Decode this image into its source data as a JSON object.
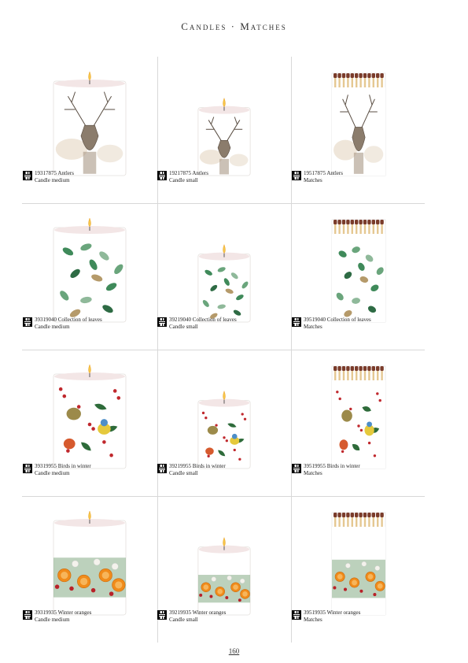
{
  "page": {
    "title": "Candles · Matches",
    "page_number": "160"
  },
  "rows": [
    {
      "motif": "antlers",
      "items": [
        {
          "code_name": "19317875 Antlers",
          "product": "Candle medium"
        },
        {
          "code_name": "19217875 Antlers",
          "product": "Candle small"
        },
        {
          "code_name": "19517875 Antlers",
          "product": "Matches"
        }
      ]
    },
    {
      "motif": "leaves",
      "items": [
        {
          "code_name": "39319040 Collection of leaves",
          "product": "Candle medium"
        },
        {
          "code_name": "39219040 Collection of leaves",
          "product": "Candle small"
        },
        {
          "code_name": "39519040 Collection of leaves",
          "product": "Matches"
        }
      ]
    },
    {
      "motif": "birds",
      "items": [
        {
          "code_name": "39319955 Birds in winter",
          "product": "Candle medium"
        },
        {
          "code_name": "39219955 Birds in winter",
          "product": "Candle small"
        },
        {
          "code_name": "39519955 Birds in winter",
          "product": "Matches"
        }
      ]
    },
    {
      "motif": "oranges",
      "items": [
        {
          "code_name": "39319935 Winter oranges",
          "product": "Candle medium"
        },
        {
          "code_name": "39219935 Winter oranges",
          "product": "Candle small"
        },
        {
          "code_name": "39519935 Winter oranges",
          "product": "Matches"
        }
      ]
    }
  ]
}
